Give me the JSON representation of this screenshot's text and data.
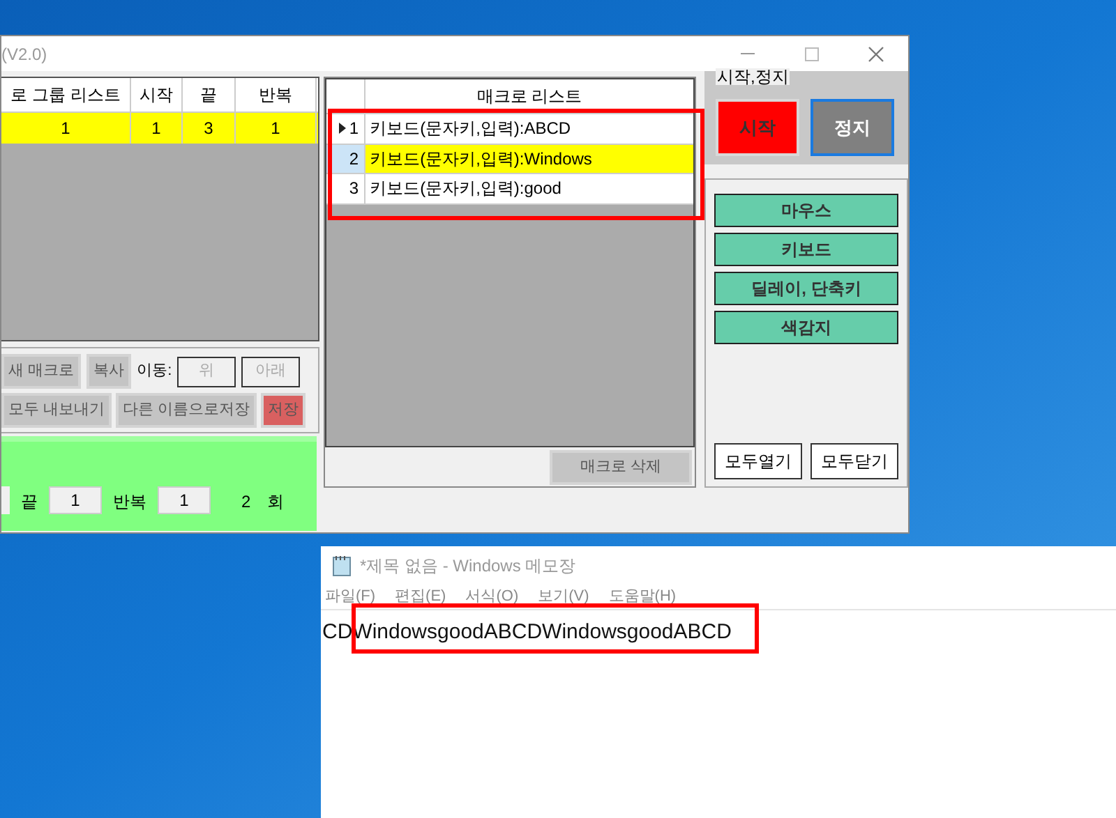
{
  "main_window": {
    "title": "(V2.0)",
    "group_list": {
      "columns": [
        "로 그룹 리스트",
        "시작",
        "끝",
        "반복"
      ],
      "rows": [
        {
          "cells": [
            "1",
            "1",
            "3",
            "1"
          ],
          "selected": true
        }
      ]
    },
    "macro_buttons": [
      "새 매크로",
      "복사"
    ],
    "move": {
      "label": "이동:",
      "buttons": [
        "위",
        "아래"
      ]
    },
    "save_buttons": [
      {
        "label": "모두 내보내기",
        "kind": "plain"
      },
      {
        "label": "다른 이름으로저장",
        "kind": "plain"
      },
      {
        "label": "저장",
        "kind": "danger"
      }
    ],
    "repeat_panel": {
      "end_label": "끝",
      "end_value": "1",
      "repeat_label": "반복",
      "repeat_value": "1",
      "count": "2",
      "unit": "회"
    },
    "macro_list": {
      "title": "매크로 리스트",
      "rows": [
        {
          "index": "1",
          "text": "키보드(문자키,입력):ABCD",
          "selected": false,
          "current": true
        },
        {
          "index": "2",
          "text": "키보드(문자키,입력):Windows",
          "selected": true,
          "current": false
        },
        {
          "index": "3",
          "text": "키보드(문자키,입력):good",
          "selected": false,
          "current": false
        }
      ],
      "delete_button": "매크로 삭제"
    },
    "start_stop": {
      "title": "시작,정지",
      "buttons": [
        {
          "label": "시작",
          "kind": "start",
          "focused": false
        },
        {
          "label": "정지",
          "kind": "stop",
          "focused": true
        }
      ]
    },
    "categories": [
      "마우스",
      "키보드",
      "딜레이, 단축키",
      "색감지"
    ],
    "expand_buttons": [
      "모두열기",
      "모두닫기"
    ]
  },
  "notepad": {
    "title": "*제목 없음 - Windows 메모장",
    "menu": [
      "파일(F)",
      "편집(E)",
      "서식(O)",
      "보기(V)",
      "도움말(H)"
    ],
    "text": "CDWindowsgoodABCDWindowsgoodABCD"
  }
}
